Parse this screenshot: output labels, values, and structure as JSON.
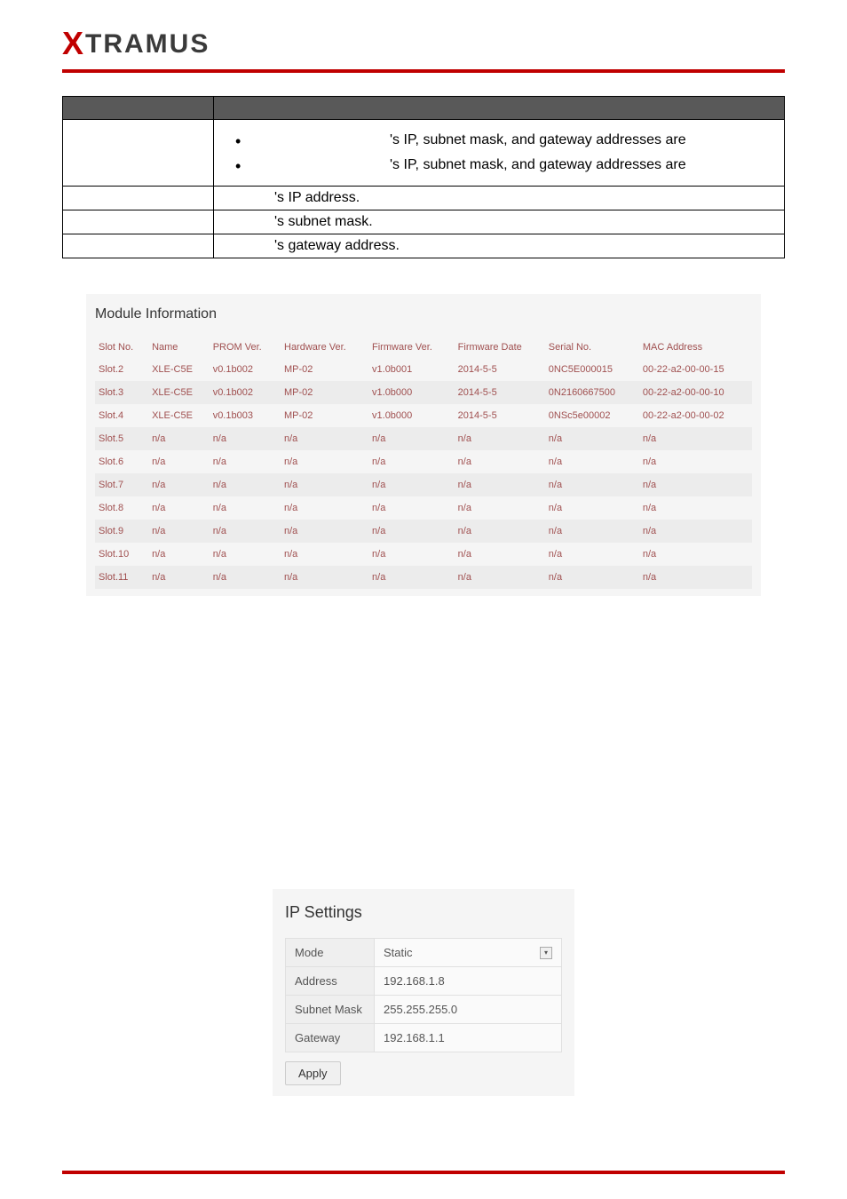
{
  "logo": {
    "x": "X",
    "rest": "TRAMUS"
  },
  "info": {
    "bullet1_suffix": "'s IP, subnet mask, and gateway addresses are",
    "bullet2_suffix": "'s IP, subnet mask, and gateway addresses are",
    "row_ip": "'s IP address.",
    "row_subnet": "'s subnet mask.",
    "row_gateway": "'s gateway address."
  },
  "module": {
    "title": "Module Information",
    "headers": [
      "Slot No.",
      "Name",
      "PROM Ver.",
      "Hardware Ver.",
      "Firmware Ver.",
      "Firmware Date",
      "Serial No.",
      "MAC Address"
    ],
    "rows": [
      [
        "Slot.2",
        "XLE-C5E",
        "v0.1b002",
        "MP-02",
        "v1.0b001",
        "2014-5-5",
        "0NC5E000015",
        "00-22-a2-00-00-15"
      ],
      [
        "Slot.3",
        "XLE-C5E",
        "v0.1b002",
        "MP-02",
        "v1.0b000",
        "2014-5-5",
        "0N2160667500",
        "00-22-a2-00-00-10"
      ],
      [
        "Slot.4",
        "XLE-C5E",
        "v0.1b003",
        "MP-02",
        "v1.0b000",
        "2014-5-5",
        "0NSc5e00002",
        "00-22-a2-00-00-02"
      ],
      [
        "Slot.5",
        "n/a",
        "n/a",
        "n/a",
        "n/a",
        "n/a",
        "n/a",
        "n/a"
      ],
      [
        "Slot.6",
        "n/a",
        "n/a",
        "n/a",
        "n/a",
        "n/a",
        "n/a",
        "n/a"
      ],
      [
        "Slot.7",
        "n/a",
        "n/a",
        "n/a",
        "n/a",
        "n/a",
        "n/a",
        "n/a"
      ],
      [
        "Slot.8",
        "n/a",
        "n/a",
        "n/a",
        "n/a",
        "n/a",
        "n/a",
        "n/a"
      ],
      [
        "Slot.9",
        "n/a",
        "n/a",
        "n/a",
        "n/a",
        "n/a",
        "n/a",
        "n/a"
      ],
      [
        "Slot.10",
        "n/a",
        "n/a",
        "n/a",
        "n/a",
        "n/a",
        "n/a",
        "n/a"
      ],
      [
        "Slot.11",
        "n/a",
        "n/a",
        "n/a",
        "n/a",
        "n/a",
        "n/a",
        "n/a"
      ]
    ]
  },
  "ip": {
    "title": "IP Settings",
    "mode_label": "Mode",
    "mode_value": "Static",
    "address_label": "Address",
    "address_value": "192.168.1.8",
    "subnet_label": "Subnet Mask",
    "subnet_value": "255.255.255.0",
    "gateway_label": "Gateway",
    "gateway_value": "192.168.1.1",
    "apply": "Apply"
  }
}
